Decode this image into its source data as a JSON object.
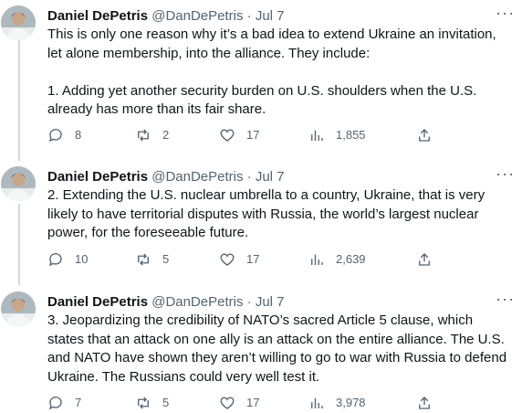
{
  "tweets": [
    {
      "name": "Daniel DePetris",
      "handle": "@DanDePetris",
      "dot": "·",
      "date": "Jul 7",
      "text": "This is only one reason why it’s a bad idea to extend Ukraine an invitation, let alone membership, into the alliance. They include:\n\n1. Adding yet another security burden on U.S. shoulders when the U.S. already has more than its fair share.",
      "replies": "8",
      "retweets": "2",
      "likes": "17",
      "views": "1,855"
    },
    {
      "name": "Daniel DePetris",
      "handle": "@DanDePetris",
      "dot": "·",
      "date": "Jul 7",
      "text": "2. Extending the U.S. nuclear umbrella to a country, Ukraine, that is very likely to have territorial disputes with Russia, the world’s largest nuclear power, for the foreseeable future.",
      "replies": "10",
      "retweets": "5",
      "likes": "17",
      "views": "2,639"
    },
    {
      "name": "Daniel DePetris",
      "handle": "@DanDePetris",
      "dot": "·",
      "date": "Jul 7",
      "text": "3. Jeopardizing the credibility of NATO’s sacred Article 5 clause, which states that an attack on one ally is an attack on the entire alliance. The U.S. and NATO have shown they aren’t willing to go to war with Russia to defend Ukraine. The Russians could very well test it.",
      "replies": "7",
      "retweets": "5",
      "likes": "17",
      "views": "3,978"
    }
  ],
  "more_label": "···"
}
